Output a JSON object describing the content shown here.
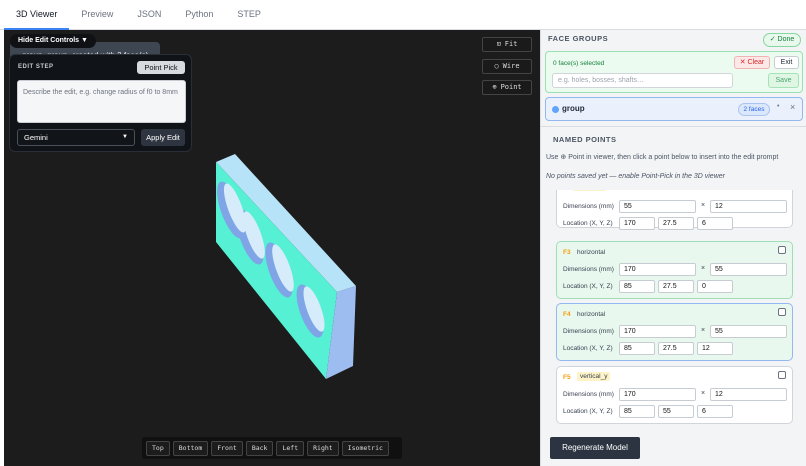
{
  "tabs": [
    {
      "label": "3D Viewer",
      "active": true
    },
    {
      "label": "Preview",
      "active": false
    },
    {
      "label": "JSON",
      "active": false
    },
    {
      "label": "Python",
      "active": false
    },
    {
      "label": "STEP",
      "active": false
    }
  ],
  "viewer": {
    "info_text": "group_group, created with 2 face(s)",
    "hide_edit_controls": "Hide Edit Controls",
    "edit_step": {
      "title": "EDIT STEP",
      "point_pick": "Point Pick",
      "placeholder": "Describe the edit, e.g. change radius of f0 to 8mm",
      "model": "Gemini",
      "apply": "Apply Edit"
    },
    "controls": {
      "fit": "Fit",
      "wire": "Wire",
      "point": "Point"
    },
    "view_buttons": [
      "Top",
      "Bottom",
      "Front",
      "Back",
      "Left",
      "Right",
      "Isometric"
    ],
    "colors": {
      "face_top": "#b7e3f8",
      "face_front": "#56f0d4",
      "face_side": "#9dbcf0",
      "background": "#1c1c1c"
    }
  },
  "face_groups": {
    "header": "FACE GROUPS",
    "done": "✓ Done",
    "selected_text": "0 face(s) selected",
    "clear": "✕ Clear",
    "exit": "Exit",
    "input_placeholder": "e.g. holes, bosses, shafts…",
    "save": "Save",
    "group": {
      "name": "group",
      "badge": "2 faces"
    }
  },
  "named_points": {
    "header": "NAMED POINTS",
    "help": "Use ⊕ Point in viewer, then click a point below to insert into the edit prompt",
    "empty": "No points saved yet — enable Point-Pick in the 3D viewer"
  },
  "faces": [
    {
      "id": "",
      "type": "vertical_y",
      "dim1": "55",
      "dim2": "12",
      "loc": [
        "170",
        "27.5",
        "6"
      ],
      "style": "white"
    },
    {
      "id": "F3",
      "type": "horizontal",
      "dim1": "170",
      "dim2": "55",
      "loc": [
        "85",
        "27.5",
        "0"
      ],
      "style": "green"
    },
    {
      "id": "F4",
      "type": "horizontal",
      "dim1": "170",
      "dim2": "55",
      "loc": [
        "85",
        "27.5",
        "12"
      ],
      "style": "selected"
    },
    {
      "id": "F5",
      "type": "vertical_y",
      "dim1": "170",
      "dim2": "12",
      "loc": [
        "85",
        "55",
        "6"
      ],
      "style": "white"
    }
  ],
  "labels": {
    "dimensions": "Dimensions (mm)",
    "location": "Location (X, Y, Z)",
    "times": "×"
  },
  "regenerate": "Regenerate Model"
}
